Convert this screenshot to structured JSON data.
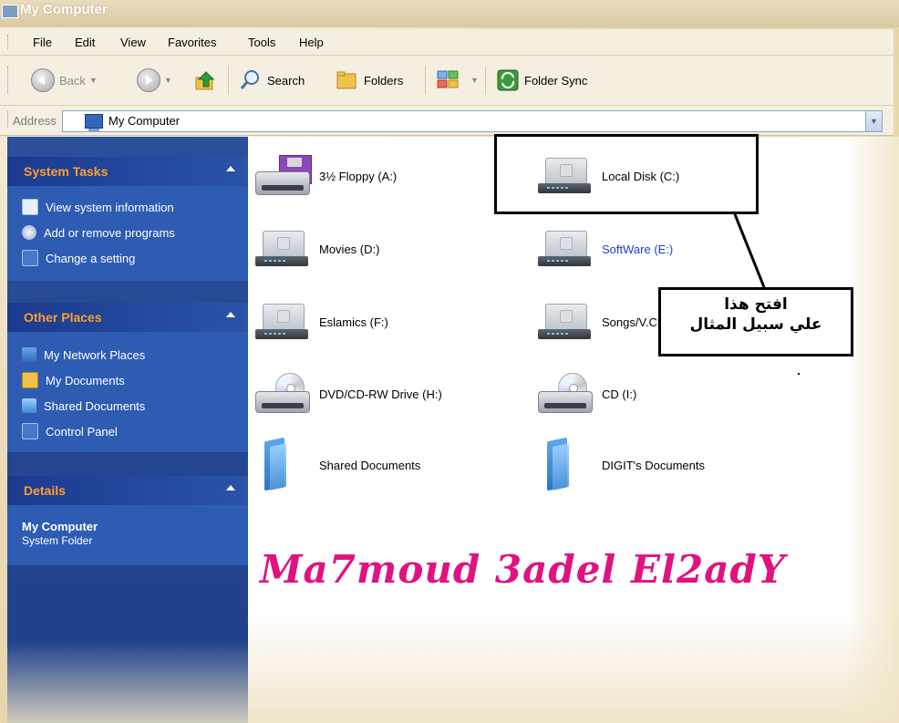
{
  "window": {
    "title": "My Computer"
  },
  "menu": [
    "File",
    "Edit",
    "View",
    "Favorites",
    "Tools",
    "Help"
  ],
  "toolbar": {
    "back": "Back",
    "search": "Search",
    "folders": "Folders",
    "folder_sync": "Folder Sync"
  },
  "address": {
    "label": "Address",
    "value": "My Computer"
  },
  "sidebar": {
    "system_tasks": {
      "title": "System Tasks",
      "items": [
        "View system information",
        "Add or remove programs",
        "Change a setting"
      ]
    },
    "other_places": {
      "title": "Other Places",
      "items": [
        "My Network Places",
        "My Documents",
        "Shared Documents",
        "Control Panel"
      ]
    },
    "details": {
      "title": "Details",
      "name": "My Computer",
      "type": "System Folder"
    }
  },
  "drives": [
    {
      "label": "3½ Floppy (A:)",
      "icon": "floppy-drive-icon"
    },
    {
      "label": "Local Disk (C:)",
      "icon": "hard-disk-icon"
    },
    {
      "label": "Movies (D:)",
      "icon": "hard-disk-icon"
    },
    {
      "label": "SoftWare (E:)",
      "icon": "hard-disk-icon"
    },
    {
      "label": "Eslamics (F:)",
      "icon": "hard-disk-icon"
    },
    {
      "label": "Songs/V.Clips (G:)",
      "icon": "hard-disk-icon"
    },
    {
      "label": "DVD/CD-RW Drive (H:)",
      "icon": "cd-drive-icon"
    },
    {
      "label": "CD (I:)",
      "icon": "cd-drive-icon"
    },
    {
      "label": "Shared Documents",
      "icon": "folder-icon"
    },
    {
      "label": "DIGIT's Documents",
      "icon": "folder-icon"
    }
  ],
  "annotation": {
    "line1": "افتح هذا",
    "line2": "علي سبيل المثال"
  },
  "watermark": "Ma7moud 3adel El2adY",
  "colors": {
    "sidebar_bg": "#2e5cb3",
    "panel_title": "#ff9d2e",
    "watermark": "#e01280",
    "link_text": "#1a3fd6"
  }
}
